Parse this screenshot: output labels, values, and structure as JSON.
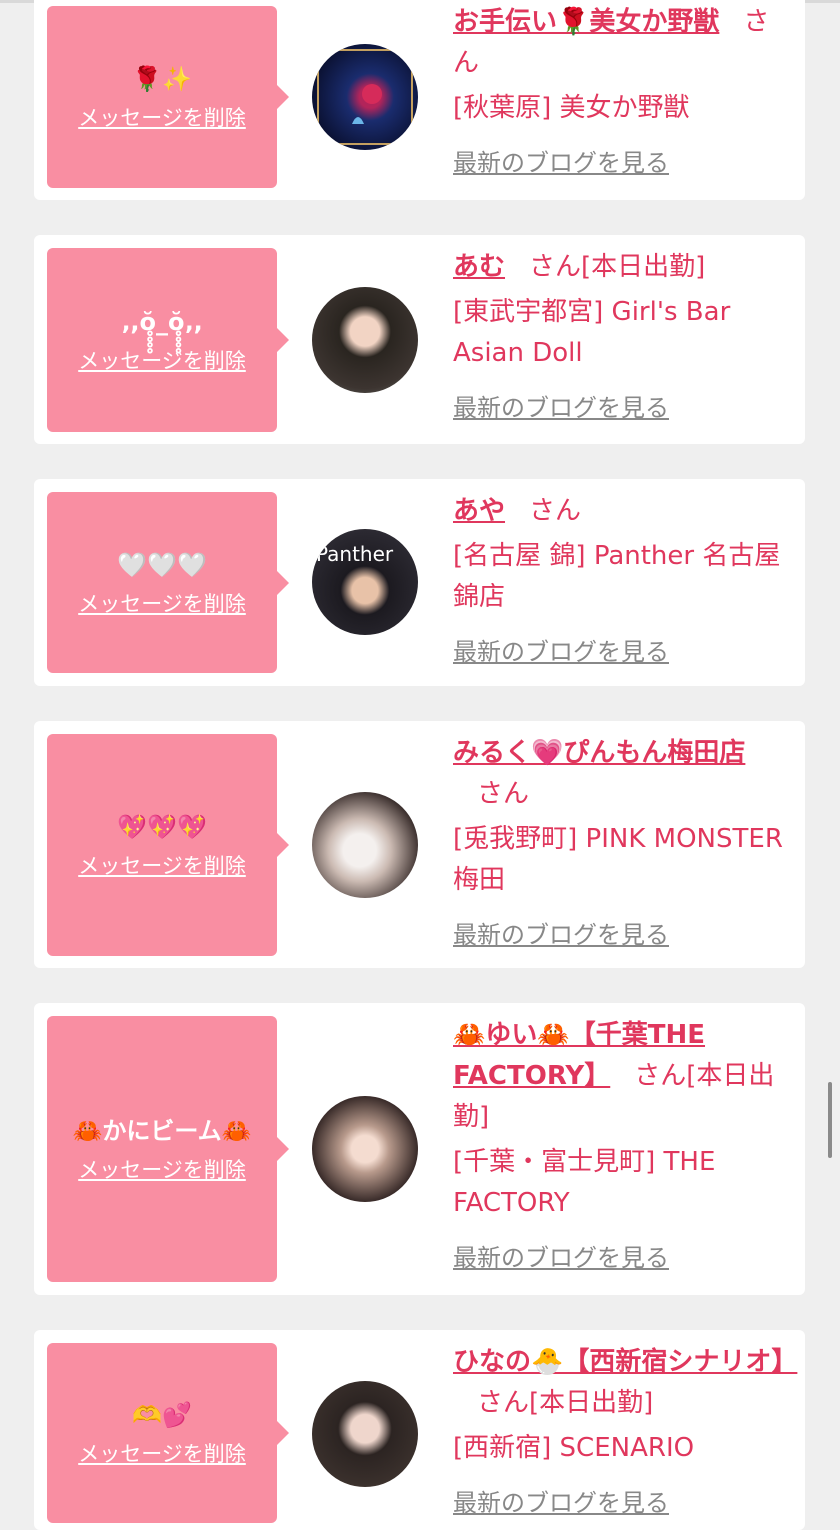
{
  "cards": [
    {
      "message": "🌹✨",
      "delete_label": "メッセージを削除",
      "name": "お手伝い🌹美女か野獣",
      "honorific": "さん",
      "status": "",
      "shop": "[秋葉原] 美女か野獣",
      "blog_label": "最新のブログを見る"
    },
    {
      "message": "‚,ŏ̥̥̥̥_ŏ̥̥̥̥‚,",
      "delete_label": "メッセージを削除",
      "name": "あむ",
      "honorific": "さん",
      "status": "[本日出勤]",
      "shop": "[東武宇都宮] Girl's Bar Asian Doll",
      "blog_label": "最新のブログを見る"
    },
    {
      "message": "🤍🤍🤍",
      "delete_label": "メッセージを削除",
      "name": "あや",
      "honorific": "さん",
      "status": "",
      "shop": "[名古屋 錦] Panther 名古屋錦店",
      "blog_label": "最新のブログを見る"
    },
    {
      "message": "💖💖💖",
      "delete_label": "メッセージを削除",
      "name": "みるく💗ぴんもん梅田店",
      "honorific": "さん",
      "status": "",
      "shop": "[兎我野町] PINK MONSTER梅田",
      "blog_label": "最新のブログを見る"
    },
    {
      "message": "🦀かにビーム🦀",
      "delete_label": "メッセージを削除",
      "name": "🦀ゆい🦀【千葉THE FACTORY】",
      "honorific": "さん",
      "status": "[本日出勤]",
      "shop": "[千葉・富士見町] THE FACTORY",
      "blog_label": "最新のブログを見る"
    },
    {
      "message": "🫶💕",
      "delete_label": "メッセージを削除",
      "name": "ひなの🐣【西新宿シナリオ】",
      "honorific": "さん",
      "status": "[本日出勤]",
      "shop": "[西新宿] SCENARIO",
      "blog_label": "最新のブログを見る"
    }
  ],
  "colors": {
    "accent": "#e0375d",
    "bubble": "#f98ea2",
    "link_gray": "#888888",
    "background": "#efefef"
  }
}
